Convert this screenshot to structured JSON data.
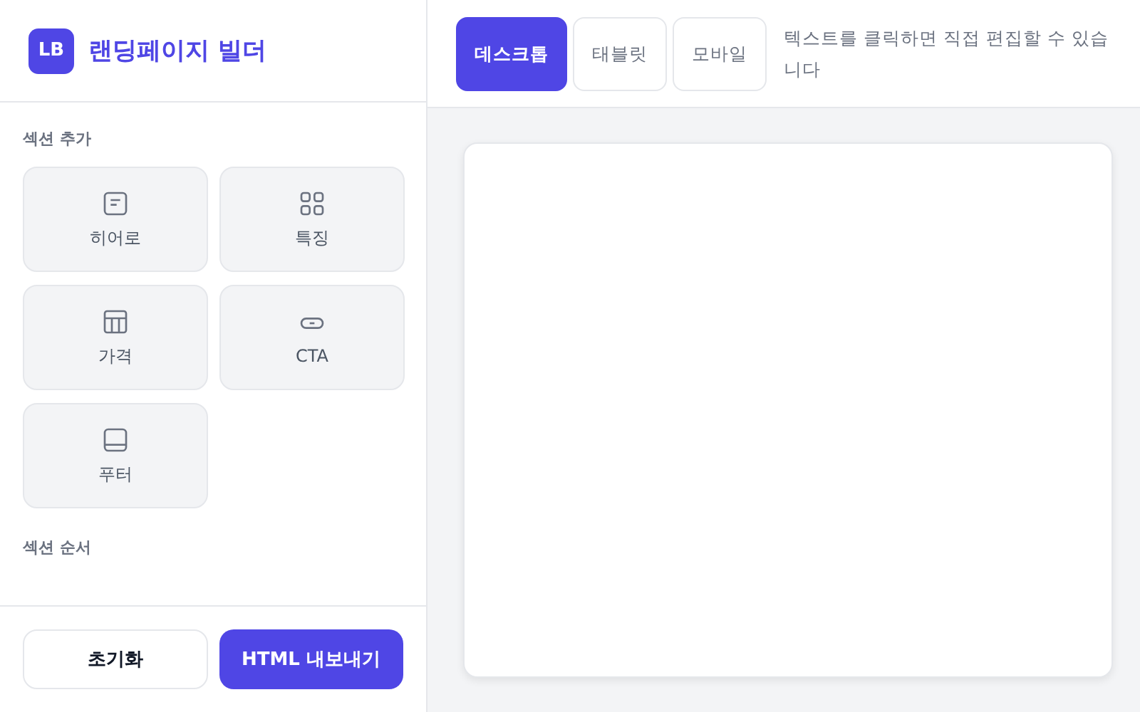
{
  "brand": {
    "logo": "LB",
    "title": "랜딩페이지 빌더"
  },
  "add_section": {
    "heading": "섹션 추가",
    "items": [
      {
        "kind": "hero",
        "label": "히어로"
      },
      {
        "kind": "features",
        "label": "특징"
      },
      {
        "kind": "pricing",
        "label": "가격"
      },
      {
        "kind": "cta",
        "label": "CTA"
      },
      {
        "kind": "footer",
        "label": "푸터"
      }
    ]
  },
  "section_order": {
    "heading": "섹션 순서"
  },
  "footer_buttons": [
    {
      "kind": "secondary",
      "label": "초기화"
    },
    {
      "kind": "primary",
      "label": "HTML 내보내기"
    }
  ],
  "view_tabs": [
    {
      "label": "데스크톱",
      "selected": true
    },
    {
      "label": "태블릿",
      "selected": false
    },
    {
      "label": "모바일",
      "selected": false
    }
  ],
  "hint": "텍스트를 클릭하면 직접 편집할 수 있습니다"
}
